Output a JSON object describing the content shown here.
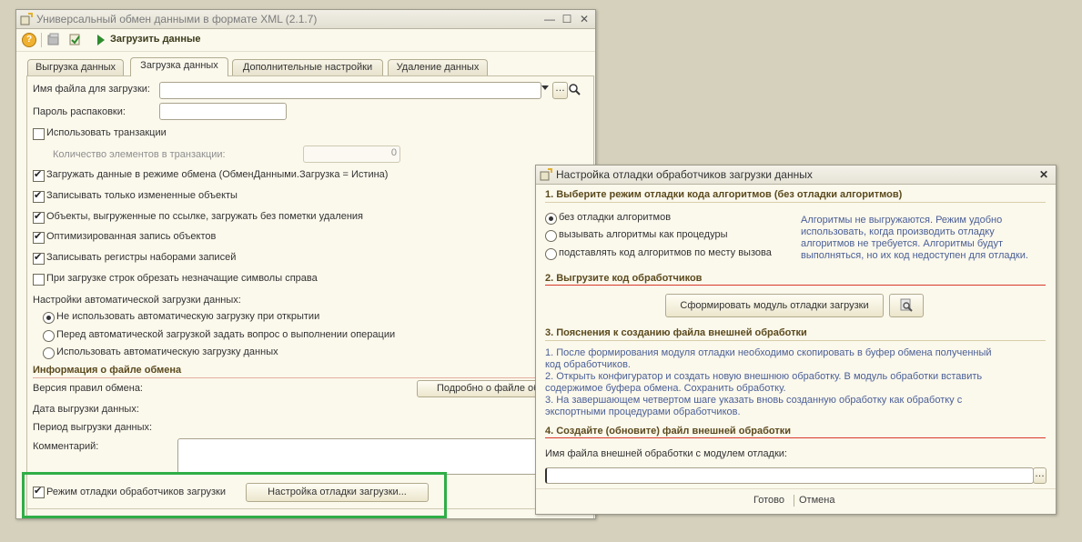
{
  "main_window": {
    "title": "Универсальный обмен данными в формате XML (2.1.7)",
    "toolbar": {
      "load_label": "Загрузить данные"
    },
    "tabs": [
      "Выгрузка данных",
      "Загрузка данных",
      "Дополнительные настройки",
      "Удаление данных"
    ],
    "file_label": "Имя файла для загрузки:",
    "file_value": "",
    "password_label": "Пароль распаковки:",
    "use_transactions": "Использовать транзакции",
    "transaction_count_label": "Количество элементов в транзакции:",
    "transaction_count_value": "0",
    "checkboxes": [
      {
        "label": "Загружать данные в режиме обмена (ОбменДанными.Загрузка = Истина)",
        "checked": true
      },
      {
        "label": "Записывать только измененные объекты",
        "checked": true
      },
      {
        "label": "Объекты, выгруженные по ссылке, загружать без пометки удаления",
        "checked": true
      },
      {
        "label": "Оптимизированная запись объектов",
        "checked": true
      },
      {
        "label": "Записывать регистры наборами записей",
        "checked": true
      },
      {
        "label": "При загрузке строк обрезать незначащие символы справа",
        "checked": false
      }
    ],
    "auto_load_label": "Настройки автоматической загрузки данных:",
    "auto_load_options": [
      {
        "label": "Не использовать автоматическую загрузку при открытии",
        "selected": true
      },
      {
        "label": "Перед автоматической загрузкой задать вопрос о выполнении операции",
        "selected": false
      },
      {
        "label": "Использовать автоматическую загрузку данных",
        "selected": false
      }
    ],
    "info_section": "Информация о файле обмена",
    "rules_version_label": "Версия правил обмена:",
    "details_button": "Подробно о файле обмена",
    "export_date_label": "Дата выгрузки данных:",
    "export_period_label": "Период выгрузки данных:",
    "comment_label": "Комментарий:",
    "debug_mode_label": "Режим отладки обработчиков загрузки",
    "debug_mode_checked": true,
    "debug_settings_button": "Настройка отладки загрузки...",
    "highlight_color": "#2fae47"
  },
  "dialog": {
    "title": "Настройка отладки обработчиков загрузки данных",
    "step1": "1. Выберите режим отладки кода алгоритмов (без отладки алгоритмов)",
    "step1_options": [
      {
        "label": "без отладки алгоритмов",
        "selected": true
      },
      {
        "label": "вызывать алгоритмы как процедуры",
        "selected": false
      },
      {
        "label": "подставлять код алгоритмов по месту вызова",
        "selected": false
      }
    ],
    "step1_hint": [
      "Алгоритмы не выгружаются. Режим удобно",
      "использовать, когда производить отладку",
      "алгоритмов не требуется. Алгоритмы будут",
      "выполняться, но их код недоступен для отладки."
    ],
    "step2": "2. Выгрузите код обработчиков",
    "generate_button": "Сформировать модуль отладки загрузки",
    "step3": "3. Пояснения к созданию файла внешней обработки",
    "step3_text": [
      "1. После формирования модуля отладки необходимо скопировать в буфер обмена полученный",
      "код обработчиков.",
      "2. Открыть конфигуратор и создать новую внешнюю обработку. В модуль обработки вставить",
      "содержимое буфера обмена. Сохранить обработку.",
      "3. На завершающем четвертом шаге указать вновь созданную обработку как обработку с",
      "экспортными процедурами обработчиков."
    ],
    "step4": "4. Создайте (обновите) файл внешней обработки",
    "ext_file_label": "Имя файла внешней обработки с модулем отладки:",
    "ext_file_value": "",
    "ok_label": "Готово",
    "cancel_label": "Отмена"
  }
}
